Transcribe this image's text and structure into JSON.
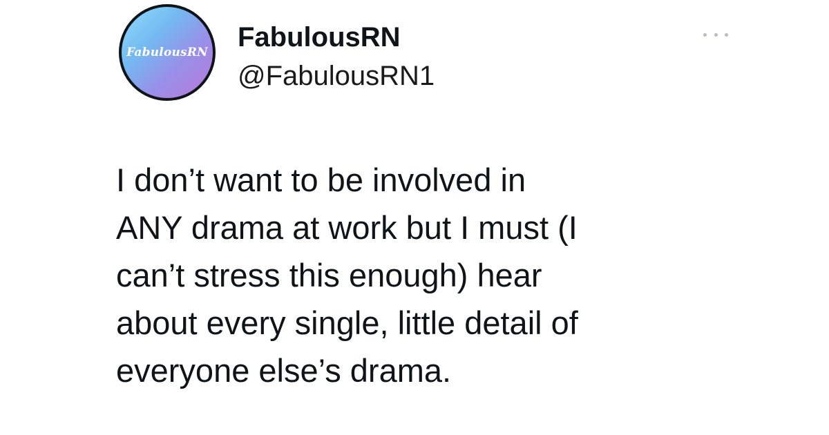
{
  "author": {
    "avatar_text": "FabulousRN",
    "display_name": "FabulousRN",
    "handle": "@FabulousRN1"
  },
  "menu": {
    "icon": "more-horizontal-icon",
    "color": "#b8bcc2"
  },
  "tweet": {
    "lines": [
      "I don’t want to be involved in",
      "ANY drama at work but I must (I",
      "can’t stress this enough) hear",
      "about every single, little detail of",
      "everyone else’s drama."
    ]
  },
  "colors": {
    "text": "#0f1419",
    "background": "#ffffff"
  }
}
